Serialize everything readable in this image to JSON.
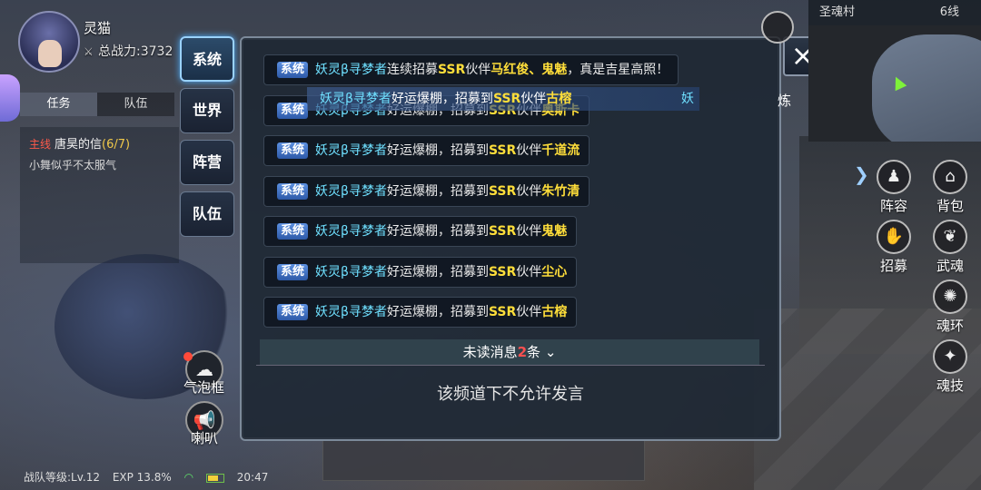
{
  "player": {
    "name": "灵猫",
    "power_label": "总战力:",
    "power_value": "3732"
  },
  "quest_tabs": [
    {
      "label": "任务",
      "active": true
    },
    {
      "label": "队伍",
      "active": false
    }
  ],
  "quest": {
    "tag": "主线",
    "title": "唐昊的信",
    "progress": "(6/7)",
    "desc": "小舞似乎不太服气"
  },
  "channel_tabs": [
    {
      "label": "系统",
      "active": true
    },
    {
      "label": "世界",
      "active": false
    },
    {
      "label": "阵营",
      "active": false
    },
    {
      "label": "队伍",
      "active": false
    }
  ],
  "chat": {
    "banner": {
      "user": "妖灵β寻梦者",
      "text": "好运爆棚，招募到",
      "ssr": "SSR",
      "mid": "伙伴",
      "partner": "古榕",
      "tail": "妖"
    },
    "messages": [
      {
        "badge": "系统",
        "user": "妖灵β寻梦者",
        "pre": "连续招募",
        "ssr": "SSR",
        "mid": "伙伴",
        "partner": "马红俊、鬼魅",
        "post": "，真是吉星高照！"
      },
      {
        "badge": "系统",
        "user": "妖灵β寻梦者",
        "pre": "好运爆棚，招募到",
        "ssr": "SSR",
        "mid": "伙伴",
        "partner": "奥斯卡",
        "post": ""
      },
      {
        "badge": "系统",
        "user": "妖灵β寻梦者",
        "pre": "好运爆棚，招募到",
        "ssr": "SSR",
        "mid": "伙伴",
        "partner": "千道流",
        "post": ""
      },
      {
        "badge": "系统",
        "user": "妖灵β寻梦者",
        "pre": "好运爆棚，招募到",
        "ssr": "SSR",
        "mid": "伙伴",
        "partner": "朱竹清",
        "post": ""
      },
      {
        "badge": "系统",
        "user": "妖灵β寻梦者",
        "pre": "好运爆棚，招募到",
        "ssr": "SSR",
        "mid": "伙伴",
        "partner": "鬼魅",
        "post": ""
      },
      {
        "badge": "系统",
        "user": "妖灵β寻梦者",
        "pre": "好运爆棚，招募到",
        "ssr": "SSR",
        "mid": "伙伴",
        "partner": "尘心",
        "post": ""
      },
      {
        "badge": "系统",
        "user": "妖灵β寻梦者",
        "pre": "好运爆棚，招募到",
        "ssr": "SSR",
        "mid": "伙伴",
        "partner": "古榕",
        "post": ""
      }
    ],
    "unread_prefix": "未读消息",
    "unread_count": "2",
    "unread_suffix": "条",
    "unread_icon": "double-chevron-down-icon",
    "no_speak": "该频道下不允许发言",
    "close_icon": "close-icon"
  },
  "bottom_left": {
    "bubble_label": "气泡框",
    "horn_label": "喇叭"
  },
  "minimap": {
    "location": "圣魂村",
    "line": "6线"
  },
  "side_label": "炼",
  "right_menu": [
    {
      "label": "阵容",
      "icon": "team-icon"
    },
    {
      "label": "背包",
      "icon": "bag-icon"
    },
    {
      "label": "招募",
      "icon": "recruit-icon"
    },
    {
      "label": "武魂",
      "icon": "martial-soul-icon"
    },
    {
      "label": "魂环",
      "icon": "soul-ring-icon"
    },
    {
      "label": "魂技",
      "icon": "soul-skill-icon"
    }
  ],
  "status_bar": {
    "level": "战队等级:Lv.12",
    "exp": "EXP 13.8%",
    "time": "20:47"
  },
  "colors": {
    "user": "#6fe0ff",
    "ssr": "#ffde3a",
    "badge": "#3f72c6",
    "active_tab": "#9ad2ff",
    "unread": "#ff5050"
  }
}
